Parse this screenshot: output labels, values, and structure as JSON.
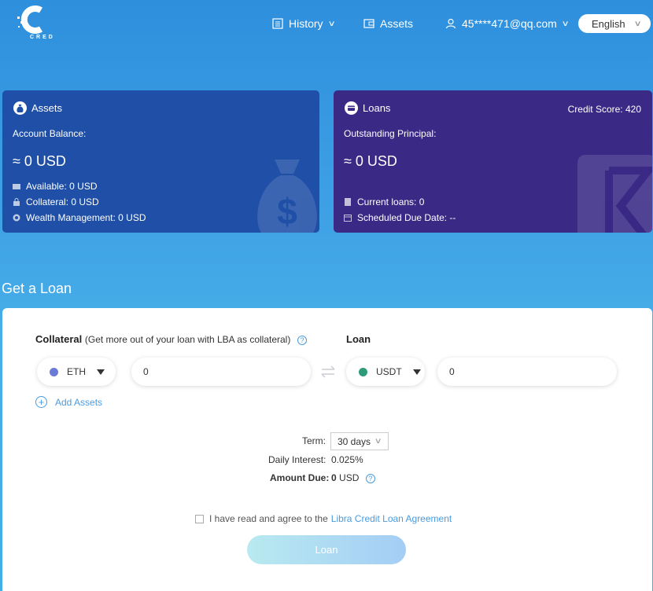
{
  "header": {
    "logo_text": "CRED",
    "nav": {
      "history_label": "History",
      "assets_label": "Assets",
      "user_label": "45****471@qq.com",
      "language_label": "English"
    }
  },
  "assets_card": {
    "title": "Assets",
    "balance_label": "Account Balance:",
    "balance_value": "≈ 0 USD",
    "available": "Available: 0 USD",
    "collateral": "Collateral: 0 USD",
    "wealth": "Wealth Management: 0 USD"
  },
  "loans_card": {
    "title": "Loans",
    "credit_score": "Credit Score: 420",
    "principal_label": "Outstanding Principal:",
    "principal_value": "≈ 0 USD",
    "current_loans": "Current loans: 0",
    "due_date": "Scheduled Due Date: --"
  },
  "get_loan": {
    "section_title": "Get a Loan",
    "collateral_label": "Collateral",
    "collateral_hint": "(Get more out of your loan with LBA as collateral)",
    "loan_label": "Loan",
    "collateral_asset": "ETH",
    "collateral_amount": "0",
    "loan_asset": "USDT",
    "loan_amount": "0",
    "add_assets": "Add Assets",
    "term_label": "Term:",
    "term_value": "30 days",
    "interest_label": "Daily Interest:",
    "interest_value": "0.025%",
    "amount_due_label": "Amount Due:",
    "amount_due_value": "0",
    "amount_due_unit": "USD",
    "agree_text": "I have read and agree to the",
    "agree_link": "Libra Credit Loan Agreement",
    "loan_button": "Loan"
  },
  "colors": {
    "assets_card": "#1f4fa6",
    "loans_card": "#3a2a86",
    "accent": "#4a9be0"
  }
}
